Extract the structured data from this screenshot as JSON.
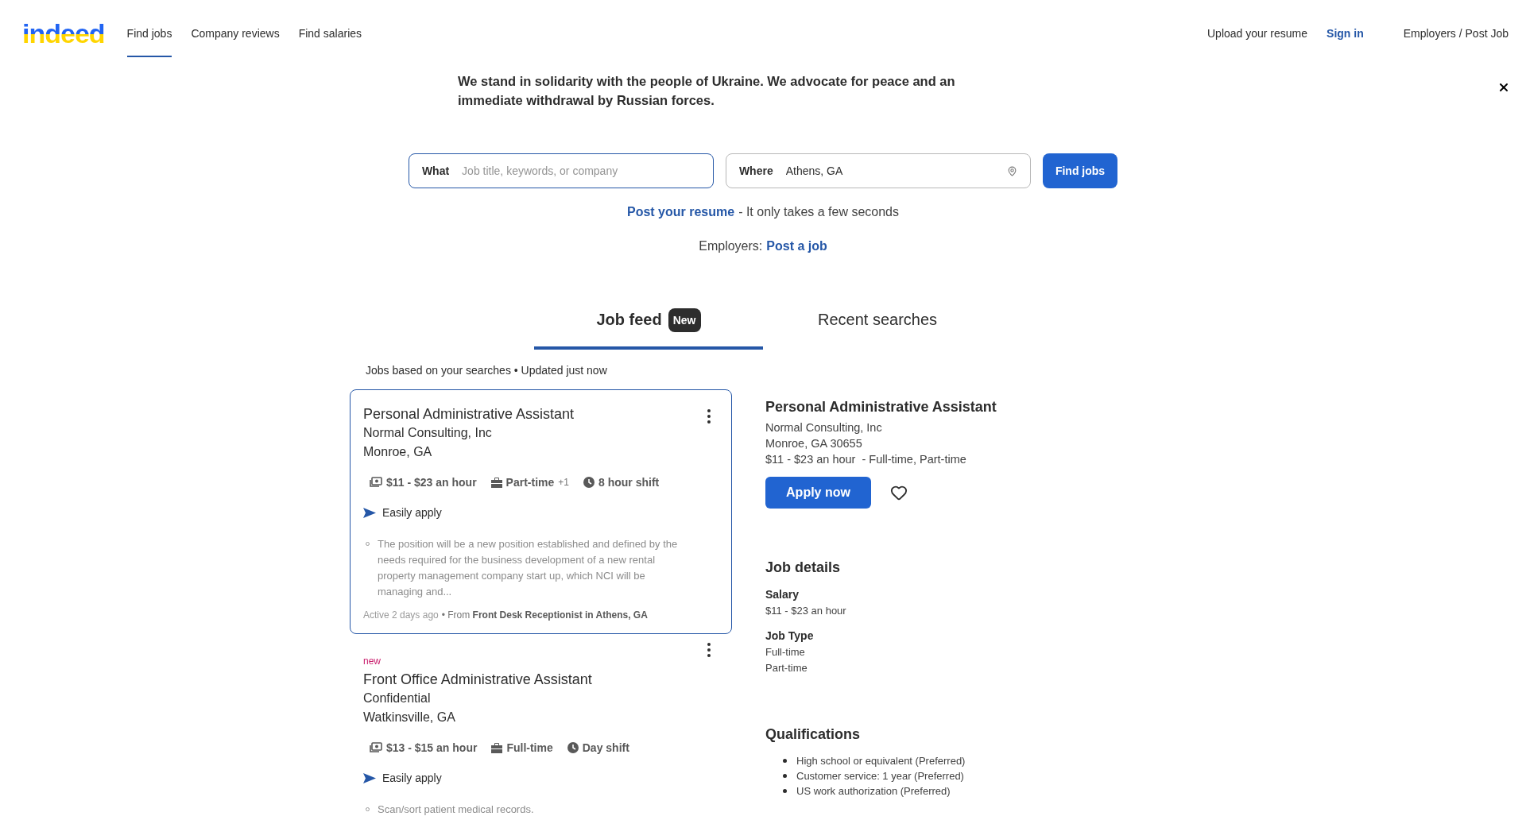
{
  "header": {
    "logo": "indeed",
    "nav": [
      {
        "label": "Find jobs",
        "selected": true
      },
      {
        "label": "Company reviews",
        "selected": false
      },
      {
        "label": "Find salaries",
        "selected": false
      }
    ],
    "links": [
      {
        "label": "Upload your resume",
        "kind": "plain"
      },
      {
        "label": "Sign in",
        "kind": "accent"
      },
      {
        "label": "Employers / Post Job",
        "kind": "plain"
      }
    ]
  },
  "banner": {
    "text": "We stand in solidarity with the people of Ukraine. We advocate for peace and an immediate withdrawal by Russian forces."
  },
  "search": {
    "what": {
      "label": "What",
      "placeholder": "Job title, keywords, or company"
    },
    "where": {
      "label": "Where",
      "value": "Athens, GA"
    },
    "button": "Find jobs"
  },
  "promo": {
    "link": "Post your resume",
    "text": "- It only takes a few seconds"
  },
  "employers": {
    "text": "Employers:",
    "link": "Post a job"
  },
  "feed_tabs": [
    {
      "label": "Job feed",
      "badge": "New",
      "selected": true
    },
    {
      "label": "Recent searches",
      "selected": false
    }
  ],
  "feed_note": "Jobs based on your searches • Updated just now",
  "jobs": [
    {
      "selected": true,
      "title": "Personal Administrative Assistant",
      "company": "Normal Consulting, Inc",
      "location": "Monroe, GA",
      "tags": [
        {
          "kind": "salary",
          "text": "$11 - $23 an hour"
        },
        {
          "kind": "type",
          "text": "Part-time",
          "extra": "+1"
        },
        {
          "kind": "shift",
          "text": "8 hour shift"
        }
      ],
      "easy_apply": "Easily apply",
      "snippet": "The position will be a new position established and defined by the needs required for the business development of a new rental property management company start up, which NCI will be managing and...",
      "active": "Active 2 days ago",
      "source": "• From **Front Desk Receptionist in Athens, GA**"
    },
    {
      "selected": false,
      "new_label": "new",
      "title": "Front Office Administrative Assistant",
      "company": "Confidential",
      "location": "Watkinsville, GA",
      "tags": [
        {
          "kind": "salary",
          "text": "$13 - $15 an hour"
        },
        {
          "kind": "type",
          "text": "Full-time"
        },
        {
          "kind": "shift",
          "text": "Day shift"
        }
      ],
      "easy_apply": "Easily apply",
      "snippet": "Scan/sort patient medical records."
    }
  ],
  "detail": {
    "title": "Personal Administrative Assistant",
    "company": "Normal Consulting, Inc",
    "location": "Monroe, GA 30655",
    "summary": "$11 - $23 an hour  - Full-time, Part-time",
    "apply": "Apply now",
    "saved": false,
    "sections": [
      {
        "heading": "Job details",
        "fields": [
          {
            "label": "Salary",
            "values": [
              "$11 - $23 an hour"
            ]
          },
          {
            "label": "Job Type",
            "values": [
              "Full-time",
              "Part-time"
            ]
          }
        ]
      },
      {
        "heading": "Qualifications",
        "bullets": [
          "High school or equivalent (Preferred)",
          "Customer service: 1 year (Preferred)",
          "US work authorization (Preferred)"
        ]
      }
    ]
  }
}
